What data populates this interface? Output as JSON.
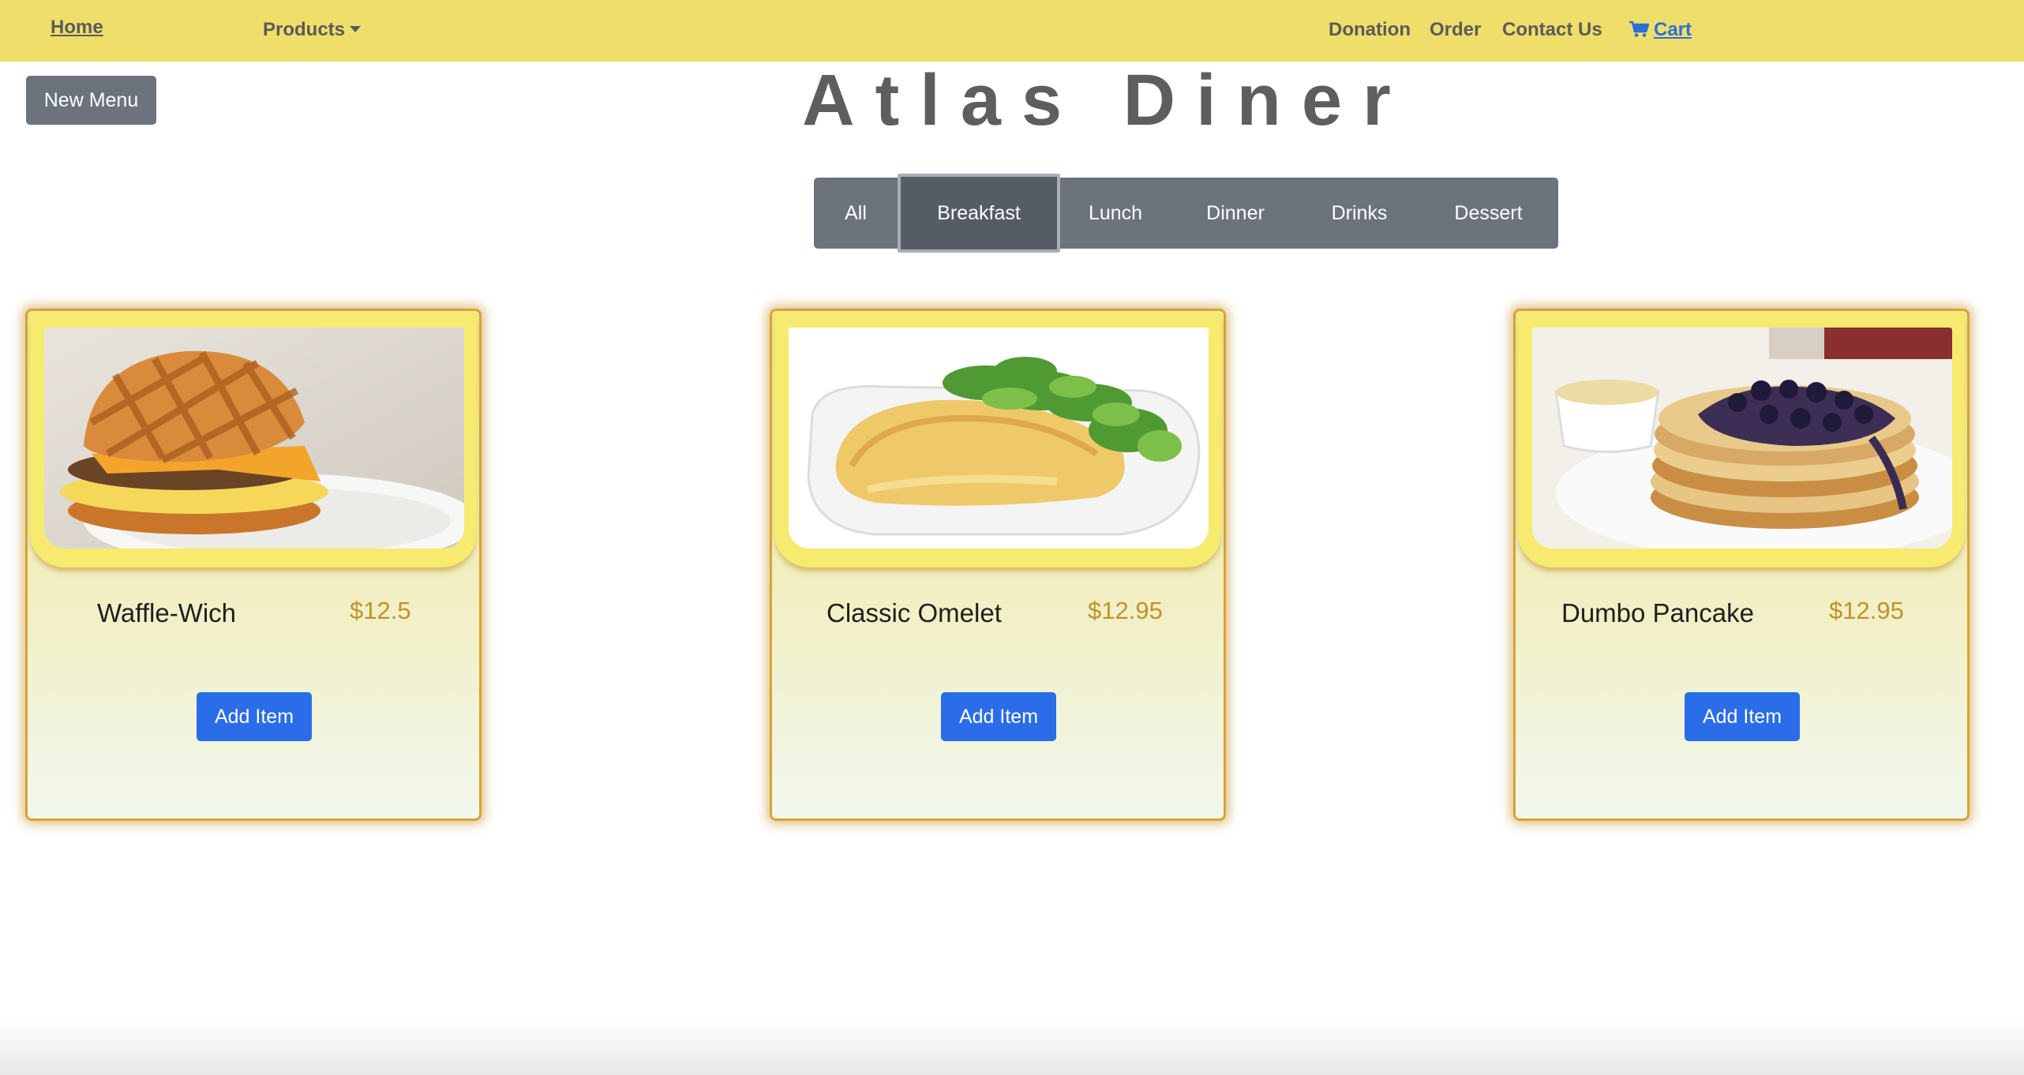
{
  "nav": {
    "home": "Home",
    "products": "Products",
    "donation": "Donation",
    "order": "Order",
    "contact": "Contact Us",
    "cart": "Cart"
  },
  "new_menu_button": "New Menu",
  "title": "Atlas Diner",
  "tabs": [
    "All",
    "Breakfast",
    "Lunch",
    "Dinner",
    "Drinks",
    "Dessert"
  ],
  "selected_tab": "Breakfast",
  "items": [
    {
      "name": "Waffle-Wich",
      "price": "$12.5",
      "button": "Add Item",
      "image": "waffle-sandwich-photo"
    },
    {
      "name": "Classic Omelet",
      "price": "$12.95",
      "button": "Add Item",
      "image": "omelet-with-greens-photo"
    },
    {
      "name": "Dumbo Pancake",
      "price": "$12.95",
      "button": "Add Item",
      "image": "blueberry-pancakes-photo"
    }
  ],
  "colors": {
    "navbar": "#f0de6a",
    "tab_bar": "#6c737d",
    "tab_selected": "#565c66",
    "add_button": "#2b6de8",
    "price": "#c39129",
    "card_border": "#d8a531",
    "cart_link": "#2c6fd6"
  }
}
